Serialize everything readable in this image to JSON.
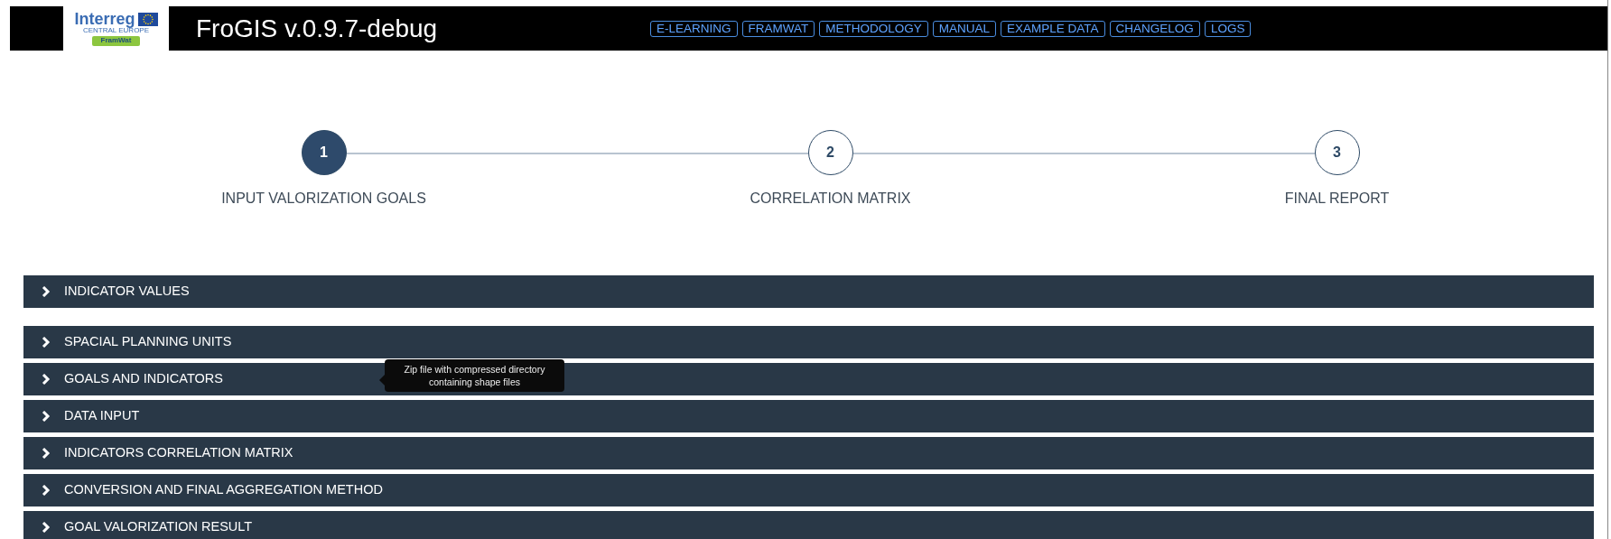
{
  "header": {
    "logo": {
      "brand": "Interreg",
      "region": "CENTRAL EUROPE",
      "project": "FramWat"
    },
    "title": "FroGIS v.0.9.7-debug",
    "links": [
      "E-LEARNING",
      "FRAMWAT",
      "METHODOLOGY",
      "MANUAL",
      "EXAMPLE DATA",
      "CHANGELOG",
      "LOGS"
    ]
  },
  "steps": [
    {
      "number": "1",
      "label": "INPUT VALORIZATION GOALS",
      "selected": true
    },
    {
      "number": "2",
      "label": "CORRELATION MATRIX",
      "selected": false
    },
    {
      "number": "3",
      "label": "FINAL REPORT",
      "selected": false
    }
  ],
  "panels": [
    {
      "title": "INDICATOR VALUES",
      "expanded": false
    },
    {
      "title": "SPACIAL PLANNING UNITS",
      "expanded": false
    },
    {
      "title": "GOALS AND INDICATORS",
      "expanded": false,
      "tooltip": "Zip file with compressed directory containing shape files"
    },
    {
      "title": "DATA INPUT",
      "expanded": false
    },
    {
      "title": "INDICATORS CORRELATION MATRIX",
      "expanded": false
    },
    {
      "title": "CONVERSION AND FINAL AGGREGATION METHOD",
      "expanded": false
    },
    {
      "title": "GOAL VALORIZATION RESULT",
      "expanded": false
    }
  ]
}
